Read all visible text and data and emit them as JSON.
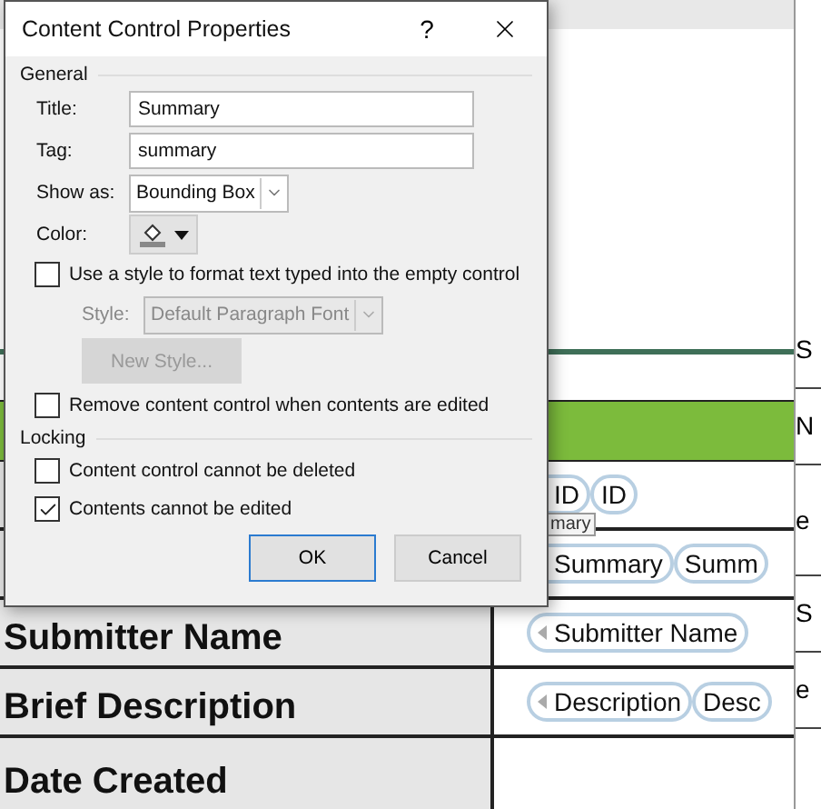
{
  "document": {
    "rows": [
      {
        "controls": [
          {
            "text": "ID"
          },
          {
            "text": "ID"
          }
        ],
        "tooltip": "mary"
      },
      {
        "controls": [
          {
            "text": "Summary"
          },
          {
            "text": "Summ"
          }
        ]
      },
      {
        "label": "Submitter Name",
        "controls": [
          {
            "text": "Submitter Name",
            "handle": true
          }
        ]
      },
      {
        "label": "Brief Description",
        "controls": [
          {
            "text": "Description",
            "handle": true
          },
          {
            "text": "Desc"
          }
        ]
      },
      {
        "label": "Date Created",
        "controls": []
      }
    ],
    "side_fragments": [
      "S",
      "N",
      "e",
      "S",
      "e"
    ]
  },
  "dialog": {
    "title": "Content Control Properties",
    "help": "?",
    "general": {
      "heading": "General",
      "fields": [
        {
          "label": "Title:",
          "value": "Summary"
        },
        {
          "label": "Tag:",
          "value": "summary"
        }
      ],
      "show_as": {
        "label": "Show as:",
        "value": "Bounding Box"
      },
      "color": {
        "label": "Color:"
      },
      "use_style": {
        "label": "Use a style to format text typed into the empty control",
        "checked": false
      },
      "style": {
        "label": "Style:",
        "value": "Default Paragraph Font",
        "disabled": true
      },
      "new_style": {
        "label": "New Style...",
        "disabled": true
      },
      "remove": {
        "label": "Remove content control when contents are edited",
        "checked": false
      }
    },
    "locking": {
      "heading": "Locking",
      "options": [
        {
          "label": "Content control cannot be deleted",
          "checked": false
        },
        {
          "label": "Contents cannot be edited",
          "checked": true
        }
      ]
    },
    "buttons": [
      {
        "label": "OK",
        "default": true
      },
      {
        "label": "Cancel",
        "default": false
      }
    ]
  }
}
